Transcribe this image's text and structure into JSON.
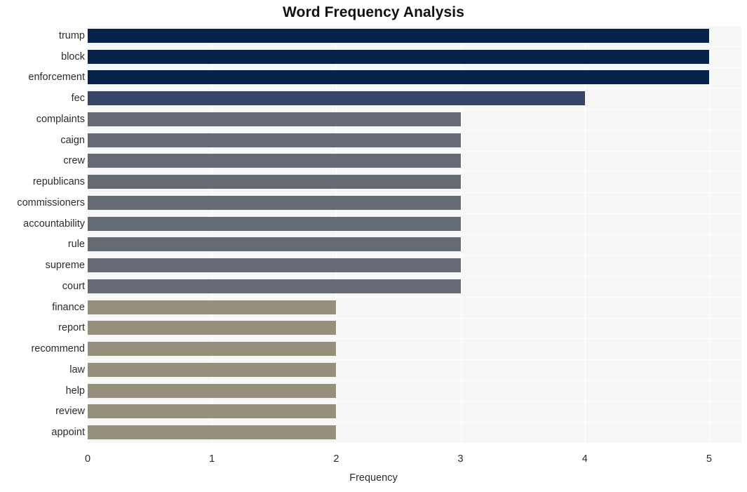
{
  "chart_data": {
    "type": "bar",
    "orientation": "horizontal",
    "title": "Word Frequency Analysis",
    "xlabel": "Frequency",
    "ylabel": "",
    "categories": [
      "trump",
      "block",
      "enforcement",
      "fec",
      "complaints",
      "caign",
      "crew",
      "republicans",
      "commissioners",
      "accountability",
      "rule",
      "supreme",
      "court",
      "finance",
      "report",
      "recommend",
      "law",
      "help",
      "review",
      "appoint"
    ],
    "values": [
      5,
      5,
      5,
      4,
      3,
      3,
      3,
      3,
      3,
      3,
      3,
      3,
      3,
      2,
      2,
      2,
      2,
      2,
      2,
      2
    ],
    "bar_colors": [
      "#06244b",
      "#06244b",
      "#06244b",
      "#374468",
      "#666a74",
      "#666a74",
      "#666a74",
      "#666a74",
      "#666a74",
      "#666a74",
      "#666a74",
      "#666a74",
      "#666a74",
      "#95907c",
      "#95907c",
      "#95907c",
      "#95907c",
      "#95907c",
      "#95907c",
      "#95907c"
    ],
    "xlim": [
      0,
      5.26
    ],
    "xticks": [
      0,
      1,
      2,
      3,
      4,
      5
    ],
    "xtick_labels": [
      "0",
      "1",
      "2",
      "3",
      "4",
      "5"
    ],
    "grid": true,
    "grid_color": "#ffffff",
    "plot_background": "#f6f6f7",
    "figure_background": "#ffffff",
    "legend": null,
    "legend_position": "none"
  }
}
